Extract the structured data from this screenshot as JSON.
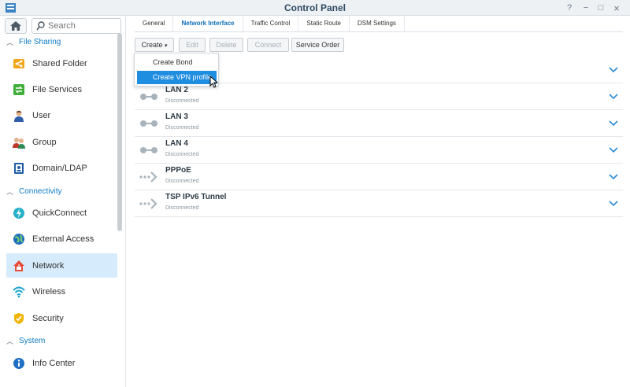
{
  "window": {
    "title": "Control Panel",
    "buttons": [
      "?",
      "−",
      "□",
      "×"
    ]
  },
  "sidebar": {
    "search_placeholder": "Search",
    "sections": [
      {
        "label": "File Sharing"
      },
      {
        "label": "Connectivity"
      },
      {
        "label": "System"
      }
    ],
    "items": [
      {
        "label": "Shared Folder",
        "icon": "shared-folder-icon"
      },
      {
        "label": "File Services",
        "icon": "file-services-icon"
      },
      {
        "label": "User",
        "icon": "user-icon"
      },
      {
        "label": "Group",
        "icon": "group-icon"
      },
      {
        "label": "Domain/LDAP",
        "icon": "domain-ldap-icon"
      },
      {
        "label": "QuickConnect",
        "icon": "quickconnect-icon"
      },
      {
        "label": "External Access",
        "icon": "external-access-icon"
      },
      {
        "label": "Network",
        "icon": "network-icon",
        "active": true
      },
      {
        "label": "Wireless",
        "icon": "wireless-icon"
      },
      {
        "label": "Security",
        "icon": "security-icon"
      },
      {
        "label": "Info Center",
        "icon": "info-center-icon"
      }
    ]
  },
  "tabs": [
    {
      "label": "General"
    },
    {
      "label": "Network Interface",
      "active": true
    },
    {
      "label": "Traffic Control"
    },
    {
      "label": "Static Route"
    },
    {
      "label": "DSM Settings"
    }
  ],
  "toolbar": {
    "create": "Create",
    "edit": "Edit",
    "delete": "Delete",
    "connect": "Connect",
    "service_order": "Service Order"
  },
  "create_menu": {
    "items": [
      {
        "label": "Create Bond"
      },
      {
        "label": "Create VPN profile",
        "highlighted": true
      }
    ]
  },
  "interfaces": [
    {
      "name": "",
      "status": ""
    },
    {
      "name": "LAN 2",
      "status": "Disconnected",
      "icon": "lan-icon"
    },
    {
      "name": "LAN 3",
      "status": "Disconnected",
      "icon": "lan-icon"
    },
    {
      "name": "LAN 4",
      "status": "Disconnected",
      "icon": "lan-icon"
    },
    {
      "name": "PPPoE",
      "status": "Disconnected",
      "icon": "pppoe-icon"
    },
    {
      "name": "TSP IPv6 Tunnel",
      "status": "Disconnected",
      "icon": "tunnel-icon"
    }
  ],
  "colors": {
    "accent": "#1f8de0",
    "active_bg": "#d6ebfb",
    "section": "#0e7bc4"
  }
}
